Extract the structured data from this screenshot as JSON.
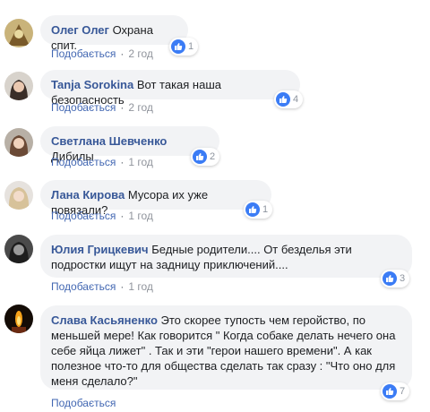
{
  "actions": {
    "like_label": "Подобається",
    "separator": "·"
  },
  "comments": [
    {
      "author": "Олег Олег",
      "text": "Охрана спит.",
      "time": "2 год",
      "likes": "1"
    },
    {
      "author": "Tanja Sorokina",
      "text": "Вот такая наша безопасность",
      "time": "2 год",
      "likes": "4"
    },
    {
      "author": "Светлана Шевченко",
      "text": "Дибилы",
      "time": "1 год",
      "likes": "2"
    },
    {
      "author": "Лана Кирова",
      "text": "Мусора их уже повязали?",
      "time": "1 год",
      "likes": "1"
    },
    {
      "author": "Юлия Грицкевич",
      "text": "Бедные родители.... От безделья эти подростки ищут на задницу приключений....",
      "time": "1 год",
      "likes": "3"
    },
    {
      "author": "Слава Касьяненко",
      "text": "Это скорее тупость чем геройство, по меньшей мере! Как говорится \" Когда собаке делать нечего она себе яйца лижет\" . Так и эти \"герои нашего времени\". А как полезное что-то для общества сделать так сразу : \"Что оно для меня сделало?\"",
      "time": "",
      "likes": "7"
    }
  ]
}
